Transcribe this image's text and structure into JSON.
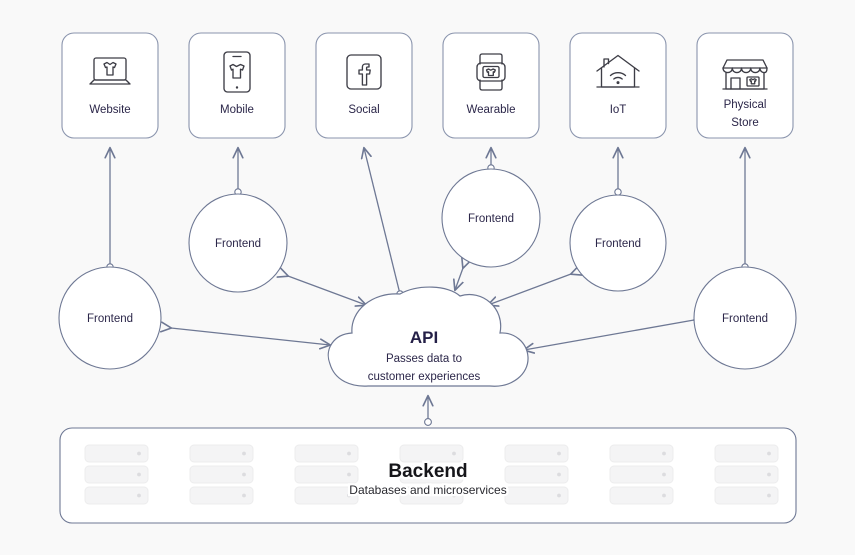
{
  "theme": {
    "background": "#f9f9f9",
    "card_fill": "#ffffff",
    "card_border": "#8a94ad",
    "node_border": "#6e7894",
    "connector": "#6e7894",
    "text_navy": "#2b2649",
    "text_dark": "#16161a",
    "rack_fill": "#f4f4f5",
    "rack_border": "#ececed"
  },
  "channels": [
    {
      "label": "Website",
      "icon": "laptop-shirt-icon"
    },
    {
      "label": "Mobile",
      "icon": "phone-shirt-icon"
    },
    {
      "label": "Social",
      "icon": "facebook-icon"
    },
    {
      "label": "Wearable",
      "icon": "smartwatch-shirt-icon"
    },
    {
      "label": "IoT",
      "icon": "house-wifi-icon"
    },
    {
      "label": "Physical",
      "label2": "Store",
      "icon": "storefront-shirt-icon"
    }
  ],
  "frontends": [
    {
      "label": "Frontend"
    },
    {
      "label": "Frontend"
    },
    {
      "label": "Frontend"
    },
    {
      "label": "Frontend"
    },
    {
      "label": "Frontend"
    }
  ],
  "api": {
    "title": "API",
    "subtitle_line1": "Passes data to",
    "subtitle_line2": "customer experiences"
  },
  "backend": {
    "title": "Backend",
    "subtitle": "Databases and microservices",
    "rack_columns": 7,
    "racks_per_column": 3
  }
}
